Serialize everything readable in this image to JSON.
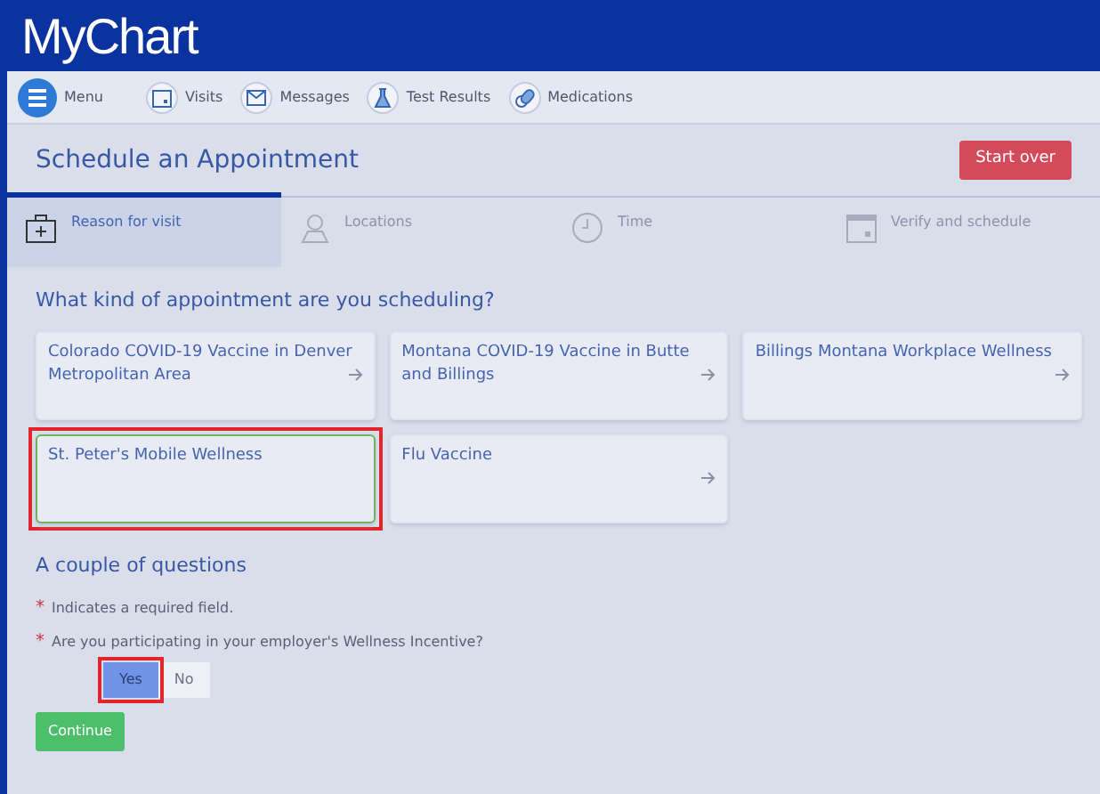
{
  "app": {
    "logo": "MyChart"
  },
  "nav": [
    {
      "kind": "menu",
      "label": "Menu"
    },
    {
      "kind": "visits",
      "label": "Visits"
    },
    {
      "kind": "messages",
      "label": "Messages"
    },
    {
      "kind": "tests",
      "label": "Test Results"
    },
    {
      "kind": "meds",
      "label": "Medications"
    }
  ],
  "page": {
    "title": "Schedule an Appointment",
    "start_over": "Start over"
  },
  "steps": [
    {
      "kind": "reason",
      "label": "Reason for visit",
      "selected": true
    },
    {
      "kind": "location",
      "label": "Locations",
      "selected": false
    },
    {
      "kind": "time",
      "label": "Time",
      "selected": false
    },
    {
      "kind": "verify",
      "label": "Verify and schedule",
      "selected": false
    }
  ],
  "question": "What kind of appointment are you scheduling?",
  "options": [
    {
      "label": "Colorado COVID-19 Vaccine in Denver Metropolitan Area",
      "selected": false,
      "highlighted": false
    },
    {
      "label": "Montana COVID-19 Vaccine in Butte and Billings",
      "selected": false,
      "highlighted": false
    },
    {
      "label": "Billings Montana Workplace Wellness",
      "selected": false,
      "highlighted": false
    },
    {
      "label": "St. Peter's Mobile Wellness",
      "selected": true,
      "highlighted": true
    },
    {
      "label": "Flu Vaccine",
      "selected": false,
      "highlighted": false
    }
  ],
  "questions": {
    "heading": "A couple of questions",
    "required_mark": "*",
    "required_note": "Indicates a required field.",
    "items": [
      {
        "mark": "*",
        "label": "Are you participating in your employer's Wellness Incentive?",
        "choices": [
          {
            "label": "Yes",
            "selected": true,
            "highlighted": true
          },
          {
            "label": "No",
            "selected": false,
            "highlighted": false
          }
        ]
      }
    ]
  },
  "continue": "Continue"
}
